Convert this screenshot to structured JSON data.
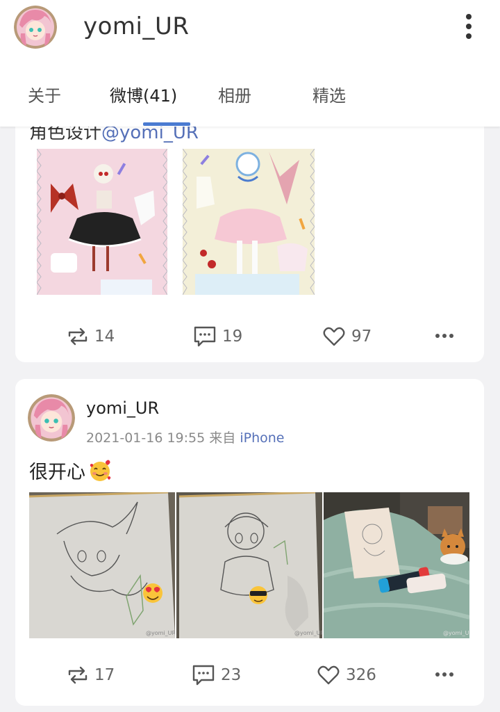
{
  "header": {
    "username": "yomi_UR",
    "tabs": [
      {
        "label": "关于",
        "active": false
      },
      {
        "label": "微博(41)",
        "active": true
      },
      {
        "label": "相册",
        "active": false
      },
      {
        "label": "精选",
        "active": false
      }
    ],
    "accent": "#4a7bd1"
  },
  "posts": [
    {
      "text_visible": "角色设计",
      "mention": "@yomi_UR",
      "images": [
        "doll-outfit-pink-black",
        "doll-outfit-cream-pink"
      ],
      "stats": {
        "reposts": "14",
        "comments": "19",
        "likes": "97"
      }
    },
    {
      "author": "yomi_UR",
      "timestamp": "2021-01-16 19:55",
      "source_prefix": "来自",
      "source": "iPhone",
      "text": "很开心",
      "emoji": "smiling-face-with-hearts",
      "images": [
        "sketch-chibi-hat",
        "sketch-chibi-sitting",
        "sketch-with-cat-and-switch"
      ],
      "image_watermark": "@yomi_UR",
      "stats": {
        "reposts": "17",
        "comments": "23",
        "likes": "326"
      }
    }
  ]
}
